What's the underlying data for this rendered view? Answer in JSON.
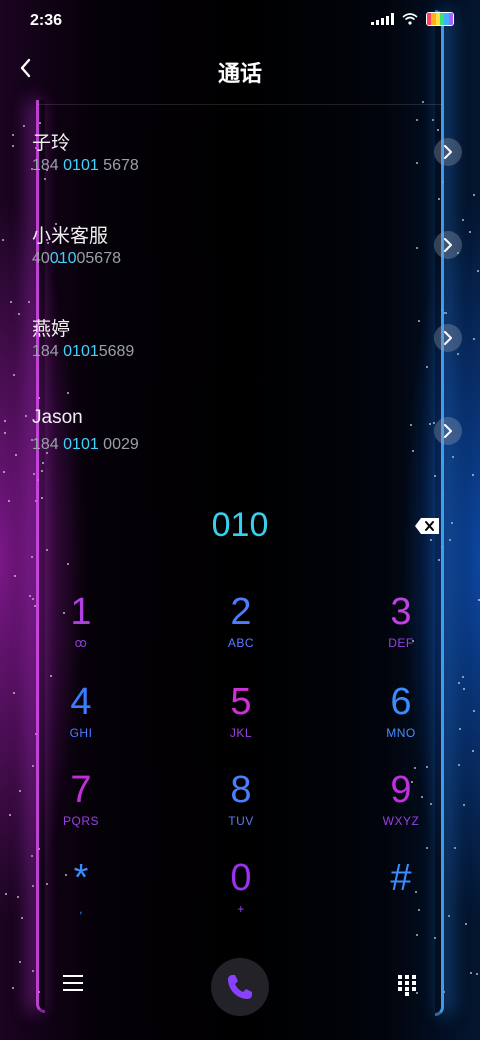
{
  "status": {
    "time": "2:36"
  },
  "header": {
    "title": "通话"
  },
  "contacts": [
    {
      "name": "子玲",
      "num_pre": "184 ",
      "num_hl": "0101",
      "num_post": " 5678"
    },
    {
      "name": "小米客服",
      "num_pre": "40",
      "num_hl": "010",
      "num_post": "05678"
    },
    {
      "name": "燕婷",
      "num_pre": "184 ",
      "num_hl": "0101",
      "num_post": "5689"
    },
    {
      "name": "Jason",
      "num_pre": "184 ",
      "num_hl": "0101",
      "num_post": " 0029"
    }
  ],
  "dialed": "010",
  "keys": [
    {
      "digit": "1",
      "letters": "ꝏ",
      "color": "#b040e0",
      "lcolor": "#8a40d0"
    },
    {
      "digit": "2",
      "letters": "ABC",
      "color": "#4a7dff",
      "lcolor": "#5a7cff"
    },
    {
      "digit": "3",
      "letters": "DEF",
      "color": "#c040e0",
      "lcolor": "#9a40e0"
    },
    {
      "digit": "4",
      "letters": "GHI",
      "color": "#3a7dff",
      "lcolor": "#4a7dff"
    },
    {
      "digit": "5",
      "letters": "JKL",
      "color": "#d030d8",
      "lcolor": "#a040e0"
    },
    {
      "digit": "6",
      "letters": "MNO",
      "color": "#3a8dff",
      "lcolor": "#4a8dff"
    },
    {
      "digit": "7",
      "letters": "PQRS",
      "color": "#c030d8",
      "lcolor": "#9a40e0"
    },
    {
      "digit": "8",
      "letters": "TUV",
      "color": "#4a7dff",
      "lcolor": "#5a7cff"
    },
    {
      "digit": "9",
      "letters": "WXYZ",
      "color": "#c030e0",
      "lcolor": "#9a40e0"
    },
    {
      "digit": "*",
      "letters": ",",
      "color": "#3a8dff",
      "lcolor": "#4a7dff"
    },
    {
      "digit": "0",
      "letters": "+",
      "color": "#9a30f0",
      "lcolor": "#9a40f0"
    },
    {
      "digit": "#",
      "letters": "",
      "color": "#3a8dff",
      "lcolor": "#4a7dff"
    }
  ],
  "colors": {
    "highlight": "#3fd3ff",
    "call_icon": "#8a40ff"
  },
  "icons": {
    "back": "chevron-left-icon",
    "go": "chevron-right-icon",
    "backspace": "backspace-icon",
    "menu": "menu-icon",
    "call": "phone-icon",
    "keypad": "keypad-icon"
  }
}
